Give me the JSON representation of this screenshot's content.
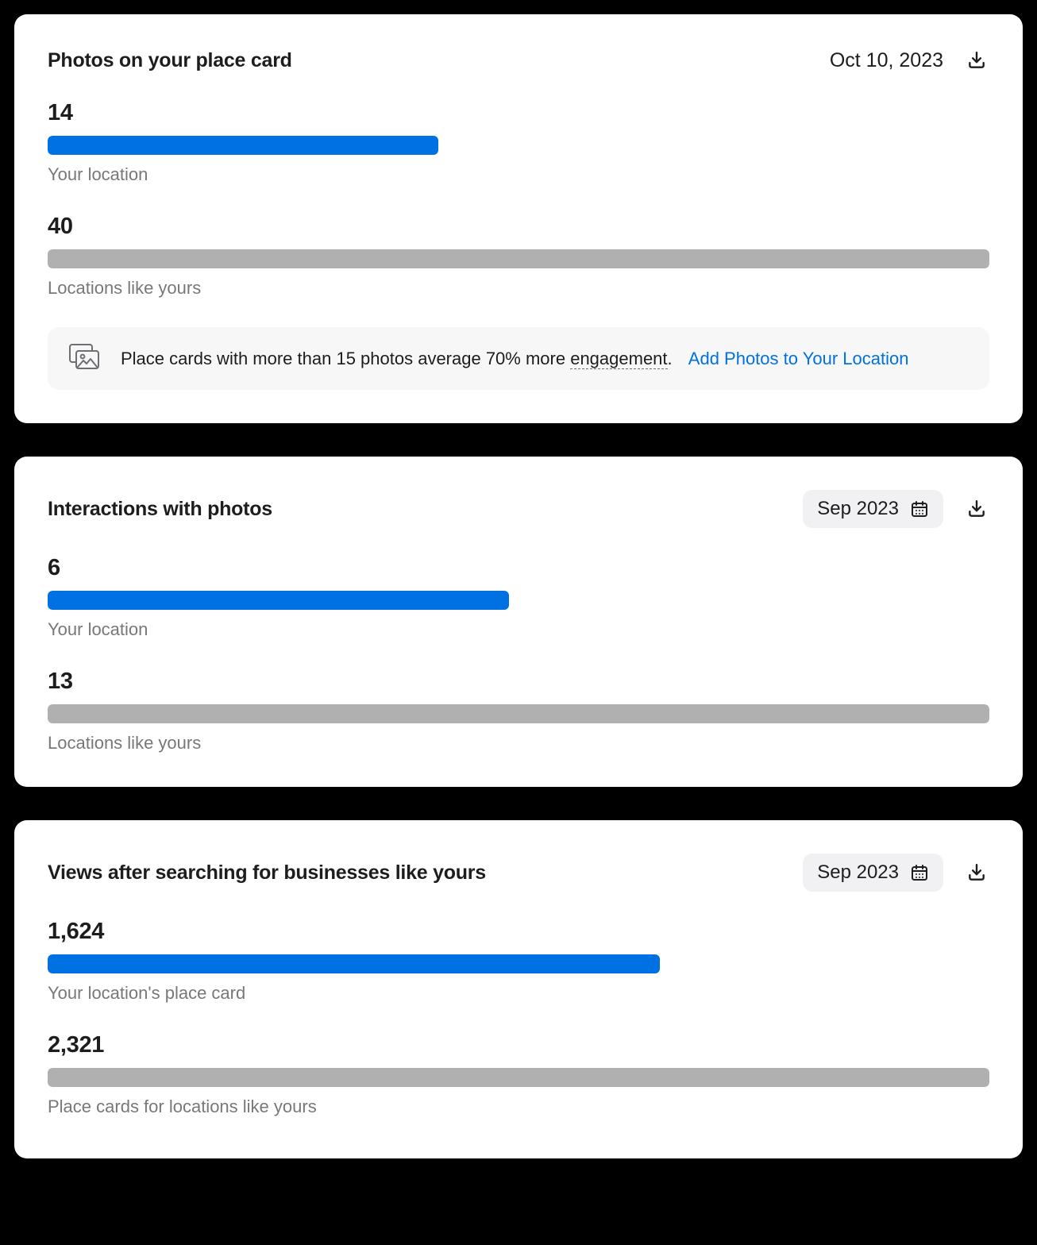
{
  "cards": {
    "photos": {
      "title": "Photos on your place card",
      "date": "Oct 10, 2023",
      "metric1": {
        "value": "14",
        "label": "Your location"
      },
      "metric2": {
        "value": "40",
        "label": "Locations like yours"
      },
      "tip": {
        "text_prefix": "Place cards with more than 15 photos average 70% more ",
        "underlined": "engagement",
        "suffix": ".",
        "link": "Add Photos to Your Location"
      }
    },
    "interactions": {
      "title": "Interactions with photos",
      "date": "Sep 2023",
      "metric1": {
        "value": "6",
        "label": "Your location"
      },
      "metric2": {
        "value": "13",
        "label": "Locations like yours"
      }
    },
    "views": {
      "title": "Views after searching for businesses like yours",
      "date": "Sep 2023",
      "metric1": {
        "value": "1,624",
        "label": "Your location's place card"
      },
      "metric2": {
        "value": "2,321",
        "label": "Place cards for locations like yours"
      }
    }
  },
  "chart_data": [
    {
      "type": "bar",
      "title": "Photos on your place card",
      "categories": [
        "Your location",
        "Locations like yours"
      ],
      "values": [
        14,
        40
      ],
      "xlabel": "",
      "ylabel": "",
      "ylim": [
        0,
        40
      ]
    },
    {
      "type": "bar",
      "title": "Interactions with photos",
      "categories": [
        "Your location",
        "Locations like yours"
      ],
      "values": [
        6,
        13
      ],
      "xlabel": "",
      "ylabel": "",
      "ylim": [
        0,
        13
      ]
    },
    {
      "type": "bar",
      "title": "Views after searching for businesses like yours",
      "categories": [
        "Your location's place card",
        "Place cards for locations like yours"
      ],
      "values": [
        1624,
        2321
      ],
      "xlabel": "",
      "ylabel": "",
      "ylim": [
        0,
        2321
      ]
    }
  ],
  "colors": {
    "accent": "#0071e3",
    "comparison": "#b0b0b1"
  },
  "bar_widths": {
    "photos": {
      "self": 41.5,
      "compare": 100
    },
    "interactions": {
      "self": 49,
      "compare": 100
    },
    "views": {
      "self": 65,
      "compare": 100
    }
  }
}
